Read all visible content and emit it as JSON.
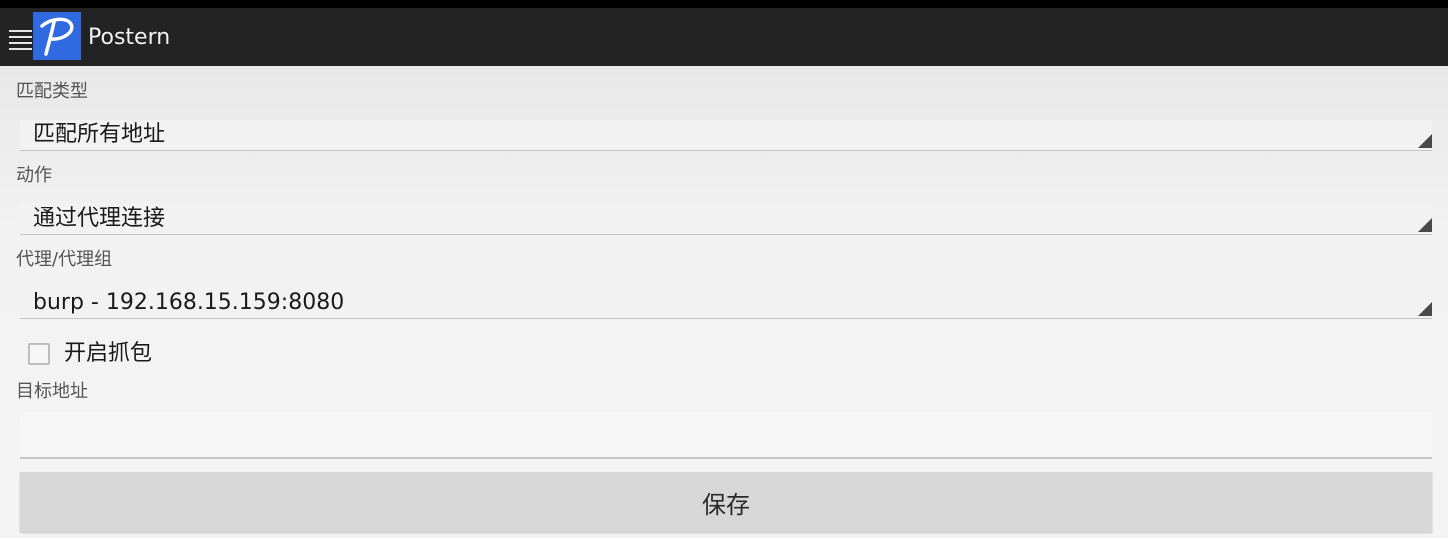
{
  "app": {
    "title": "Postern",
    "logo_letter": "P",
    "accent_color": "#2f6ae0"
  },
  "form": {
    "match_type": {
      "label": "匹配类型",
      "value": "匹配所有地址"
    },
    "action": {
      "label": "动作",
      "value": "通过代理连接"
    },
    "proxy": {
      "label": "代理/代理组",
      "value": "burp - 192.168.15.159:8080"
    },
    "capture": {
      "label": "开启抓包",
      "checked": false
    },
    "target": {
      "label": "目标地址",
      "value": ""
    },
    "save_label": "保存"
  },
  "icons": [
    "menu-icon",
    "postern-logo-icon",
    "dropdown-arrow-icon",
    "checkbox-icon"
  ]
}
